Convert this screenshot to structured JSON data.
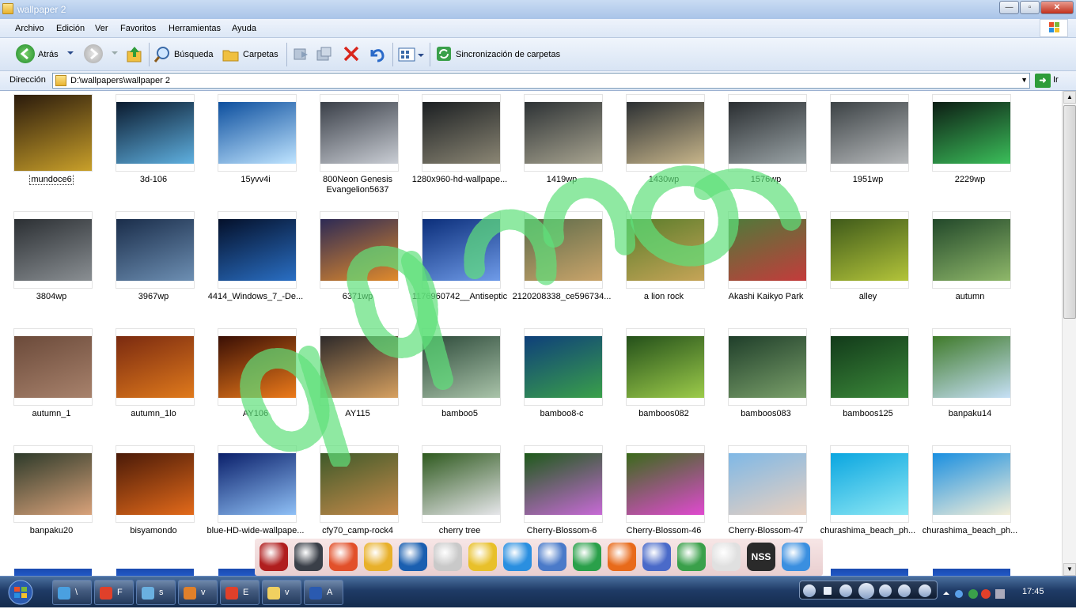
{
  "window": {
    "title": "wallpaper 2",
    "btn_minimize": "—",
    "btn_maximize": "▫",
    "btn_close": "✕"
  },
  "menu": [
    "Archivo",
    "Edición",
    "Ver",
    "Favoritos",
    "Herramientas",
    "Ayuda"
  ],
  "toolbar": {
    "back_label": "Atrás",
    "search_label": "Búsqueda",
    "folders_label": "Carpetas",
    "sync_label": "Sincronización de carpetas"
  },
  "address": {
    "label": "Dirección",
    "path": "D:\\wallpapers\\wallpaper 2",
    "go_label": "Ir"
  },
  "files": [
    {
      "name": "mundoce6",
      "c1": "#2a1a0c",
      "c2": "#c9a02a"
    },
    {
      "name": "3d-106",
      "c1": "#0a1a2e",
      "c2": "#5fb0e0"
    },
    {
      "name": "15yvv4i",
      "c1": "#0d4f9e",
      "c2": "#bfe4ff"
    },
    {
      "name": "800Neon Genesis Evangelion5637",
      "c1": "#3a3f48",
      "c2": "#c9cdd4"
    },
    {
      "name": "1280x960-hd-wallpape...",
      "c1": "#1b1f22",
      "c2": "#8b8674"
    },
    {
      "name": "1419wp",
      "c1": "#2d3235",
      "c2": "#a8a490"
    },
    {
      "name": "1430wp",
      "c1": "#2c3033",
      "c2": "#c7b58a"
    },
    {
      "name": "1576wp",
      "c1": "#2a2e31",
      "c2": "#9aa3a6"
    },
    {
      "name": "1951wp",
      "c1": "#3c4245",
      "c2": "#b6b9bb"
    },
    {
      "name": "2229wp",
      "c1": "#0d1d14",
      "c2": "#3bbf5a"
    },
    {
      "name": "3804wp",
      "c1": "#2b2f33",
      "c2": "#8a8f93"
    },
    {
      "name": "3967wp",
      "c1": "#1a2d4a",
      "c2": "#6d8fb3"
    },
    {
      "name": "4414_Windows_7_-De...",
      "c1": "#04102a",
      "c2": "#2a6fc4"
    },
    {
      "name": "6371wp",
      "c1": "#2d2a55",
      "c2": "#e08a2c"
    },
    {
      "name": "1176960742__Antiseptic",
      "c1": "#0b2e7a",
      "c2": "#6f9be8"
    },
    {
      "name": "2120208338_ce596734...",
      "c1": "#5d6b4a",
      "c2": "#c9a46a"
    },
    {
      "name": "a lion rock",
      "c1": "#5a7d2b",
      "c2": "#c6a457"
    },
    {
      "name": "Akashi Kaikyo Park",
      "c1": "#4f7a3a",
      "c2": "#c43b3b"
    },
    {
      "name": "alley",
      "c1": "#3f5a1a",
      "c2": "#b3c43a"
    },
    {
      "name": "autumn",
      "c1": "#22482a",
      "c2": "#8fb86a"
    },
    {
      "name": "autumn_1",
      "c1": "#6b4a3a",
      "c2": "#a8826c"
    },
    {
      "name": "autumn_1lo",
      "c1": "#7a2a10",
      "c2": "#e07a1c"
    },
    {
      "name": "AY106",
      "c1": "#3a0f05",
      "c2": "#ec7a1a"
    },
    {
      "name": "AY115",
      "c1": "#2e2a2a",
      "c2": "#d6a060"
    },
    {
      "name": "bamboo5",
      "c1": "#2d4a3a",
      "c2": "#a9c3a9"
    },
    {
      "name": "bamboo8-c",
      "c1": "#0e3f7a",
      "c2": "#3aa04a"
    },
    {
      "name": "bamboos082",
      "c1": "#24501a",
      "c2": "#9ccb4a"
    },
    {
      "name": "bamboos083",
      "c1": "#1f3e2a",
      "c2": "#7aa06a"
    },
    {
      "name": "bamboos125",
      "c1": "#123a1a",
      "c2": "#3c8a3a"
    },
    {
      "name": "banpaku14",
      "c1": "#3f7a2a",
      "c2": "#c6e0f6"
    },
    {
      "name": "banpaku20",
      "c1": "#2d3a2a",
      "c2": "#d9a27a"
    },
    {
      "name": "bisyamondo",
      "c1": "#4a1a08",
      "c2": "#e36a1a"
    },
    {
      "name": "blue-HD-wide-wallpape...",
      "c1": "#0a1f6a",
      "c2": "#8fc0f6"
    },
    {
      "name": "cfy70_camp-rock4",
      "c1": "#3f5a2a",
      "c2": "#c68a4a"
    },
    {
      "name": "cherry tree",
      "c1": "#2f5a1f",
      "c2": "#e6e6ea"
    },
    {
      "name": "Cherry-Blossom-6",
      "c1": "#1e5a1a",
      "c2": "#c76ad6"
    },
    {
      "name": "Cherry-Blossom-46",
      "c1": "#3a6a1a",
      "c2": "#e04ad0"
    },
    {
      "name": "Cherry-Blossom-47",
      "c1": "#7fb8e6",
      "c2": "#e8d0c0"
    },
    {
      "name": "churashima_beach_ph...",
      "c1": "#0aa6e0",
      "c2": "#8fe8f4"
    },
    {
      "name": "churashima_beach_ph...",
      "c1": "#1a8fe0",
      "c2": "#f4efd9"
    }
  ],
  "dock": [
    {
      "icon": "download-manager-icon",
      "c": "#b01e1e"
    },
    {
      "icon": "disk-utility-icon",
      "c": "#3a3f48"
    },
    {
      "icon": "ccleaner-icon",
      "c": "#e2502a"
    },
    {
      "icon": "daemon-tools-icon",
      "c": "#e8b02a"
    },
    {
      "icon": "cpu-speed-icon",
      "c": "#1a5fb0"
    },
    {
      "icon": "fax-icon",
      "c": "#c9c9c9"
    },
    {
      "icon": "tools-icon",
      "c": "#e8c02a"
    },
    {
      "icon": "quicktime-icon",
      "c": "#2a8fe0"
    },
    {
      "icon": "remote-desktop-icon",
      "c": "#4a7ac9"
    },
    {
      "icon": "spiral-app-icon",
      "c": "#2aa04a"
    },
    {
      "icon": "fire-app-icon",
      "c": "#e86a1a"
    },
    {
      "icon": "hardware-icon",
      "c": "#4a6ac9"
    },
    {
      "icon": "users-icon",
      "c": "#3aa04a"
    },
    {
      "icon": "draw-app-icon",
      "c": "#e0e0e0"
    },
    {
      "icon": "nss-icon",
      "c": "#2a2a2a"
    },
    {
      "icon": "water-drop-icon",
      "c": "#3a8fe0"
    }
  ],
  "nss_label": "NSS",
  "taskbar": {
    "buttons": [
      {
        "label": "\\",
        "c": "#4aa0e0"
      },
      {
        "label": "F",
        "c": "#e0402a"
      },
      {
        "label": "s",
        "c": "#6ab0e0"
      },
      {
        "label": "v",
        "c": "#e0802a"
      },
      {
        "label": "E",
        "c": "#e0402a"
      },
      {
        "label": "v",
        "c": "#f0d060"
      },
      {
        "label": "A",
        "c": "#2a5ab0"
      }
    ],
    "clock": "17:45"
  }
}
